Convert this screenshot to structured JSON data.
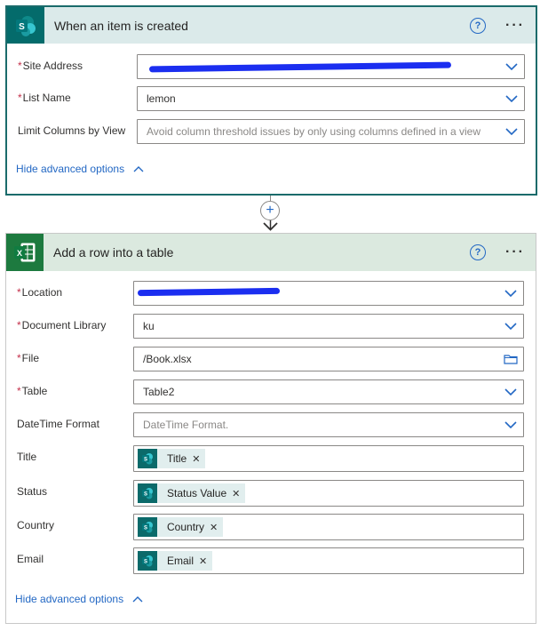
{
  "trigger": {
    "title": "When an item is created",
    "help": "?",
    "more": "···",
    "fields": [
      {
        "label": "Site Address",
        "required": "*",
        "value": ""
      },
      {
        "label": "List Name",
        "required": "*",
        "value": "lemon"
      },
      {
        "label": "Limit Columns by View",
        "required": "",
        "placeholder": "Avoid column threshold issues by only using columns defined in a view"
      }
    ],
    "advanced": "Hide advanced options"
  },
  "add_step": {
    "plus": "+"
  },
  "action": {
    "title": "Add a row into a table",
    "help": "?",
    "more": "···",
    "fields": [
      {
        "label": "Location",
        "required": "*",
        "value": ""
      },
      {
        "label": "Document Library",
        "required": "*",
        "value": "ku"
      },
      {
        "label": "File",
        "required": "*",
        "value": "/Book.xlsx"
      },
      {
        "label": "Table",
        "required": "*",
        "value": "Table2"
      },
      {
        "label": "DateTime Format",
        "required": "",
        "placeholder": "DateTime Format."
      },
      {
        "label": "Title",
        "required": "",
        "token": "Title"
      },
      {
        "label": "Status",
        "required": "",
        "token": "Status Value"
      },
      {
        "label": "Country",
        "required": "",
        "token": "Country"
      },
      {
        "label": "Email",
        "required": "",
        "token": "Email"
      }
    ],
    "advanced": "Hide advanced options"
  },
  "colors": {
    "accent": "#2368c4",
    "sharepoint": "#046b6b",
    "excel": "#1d7a3f",
    "required": "#c4314b"
  },
  "icons": {
    "sharepoint": "sharepoint-icon",
    "excel": "excel-icon",
    "chevron": "chevron-down-icon",
    "folder": "folder-icon"
  }
}
